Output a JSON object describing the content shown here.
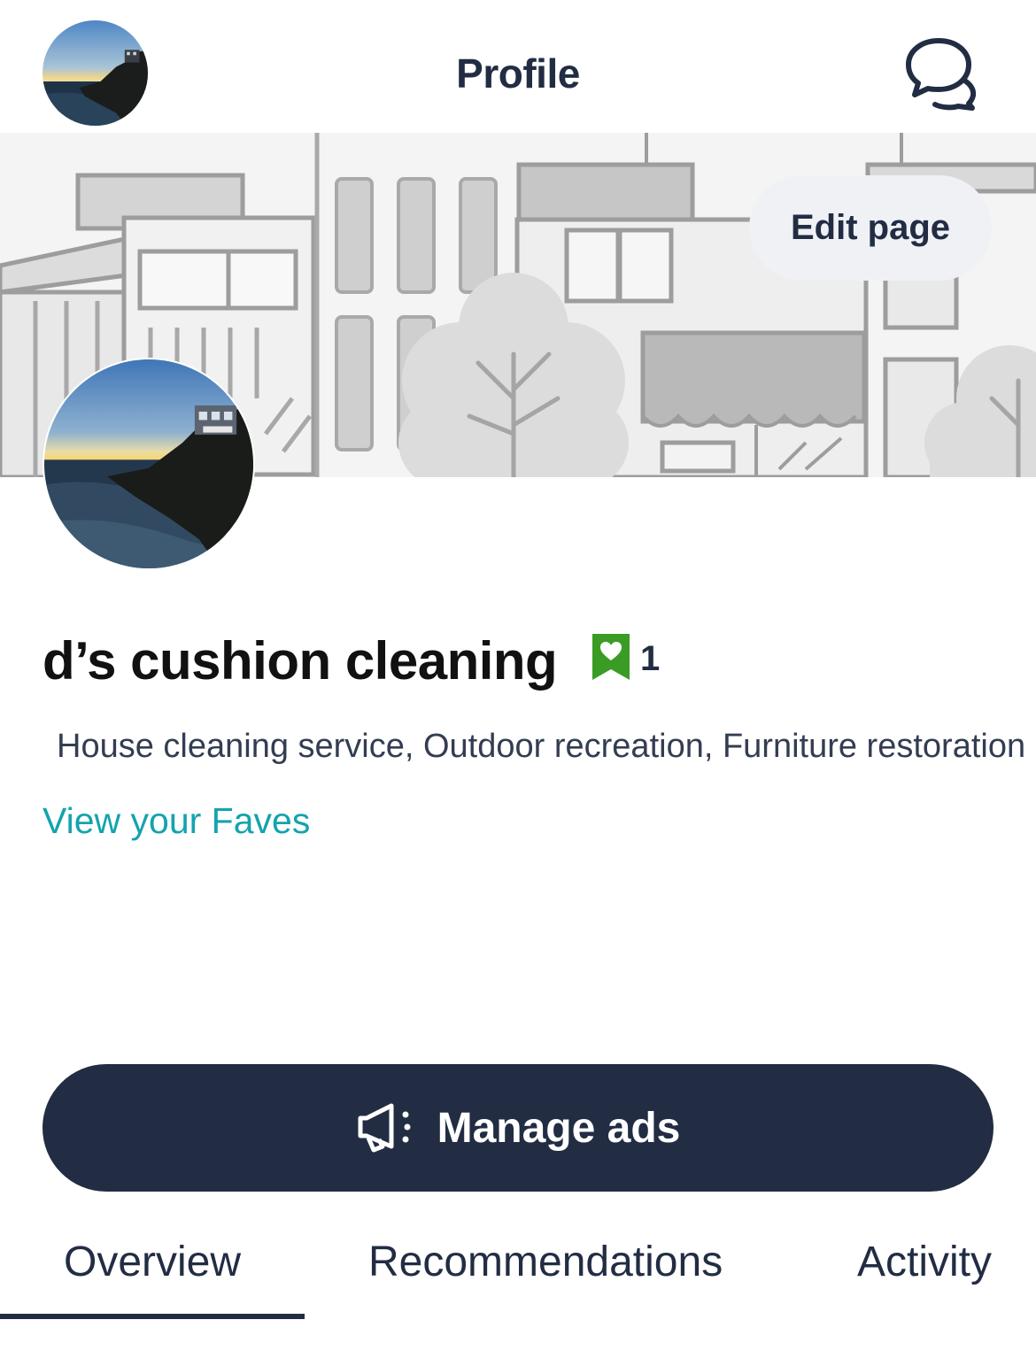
{
  "header": {
    "title": "Profile",
    "avatar_icon": "profile-photo-seaside",
    "chat_icon": "chat-bubbles-icon"
  },
  "cover": {
    "edit_label": "Edit page"
  },
  "profile": {
    "name": "d’s cushion cleaning",
    "fave_badge_icon": "heart-bookmark-icon",
    "fave_count": "1",
    "categories": "House cleaning service, Outdoor recreation, Furniture restoration",
    "view_faves_label": "View your Faves"
  },
  "actions": {
    "manage_ads_label": "Manage ads",
    "manage_ads_icon": "megaphone-icon"
  },
  "tabs": [
    {
      "label": "Overview",
      "selected": true
    },
    {
      "label": "Recommendations",
      "selected": false
    },
    {
      "label": "Activity",
      "selected": false
    }
  ],
  "colors": {
    "navy": "#222d44",
    "link_teal": "#14a3ae",
    "badge_green": "#3a9c25",
    "pill_bg": "#eff1f5"
  }
}
